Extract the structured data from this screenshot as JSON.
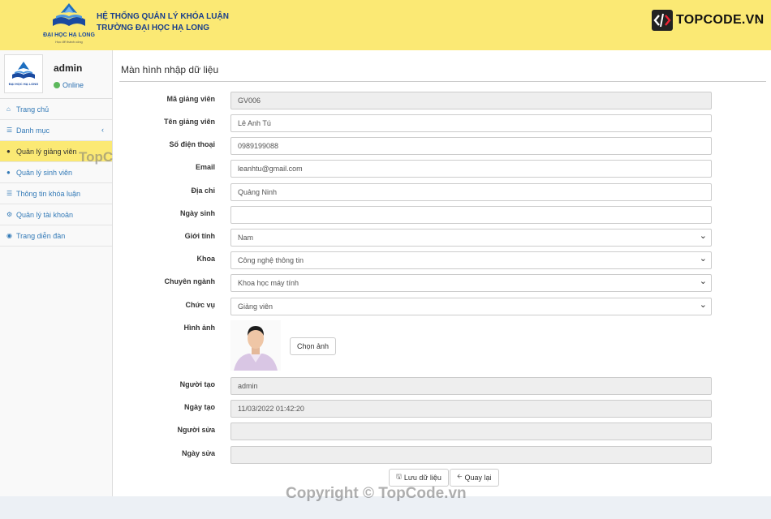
{
  "header": {
    "logo_text": "ĐẠI HỌC HẠ LONG",
    "logo_slogan": "Học để thành công",
    "title_line1": "HỆ THỐNG QUẢN LÝ KHÓA LUẬN",
    "title_line2": "TRƯỜNG ĐẠI HỌC HẠ LONG",
    "brand": "TOPCODE.VN"
  },
  "sidebar": {
    "avatar_text": "ĐẠI HỌC HẠ LONG",
    "user_name": "admin",
    "user_status": "Online",
    "items": [
      {
        "label": "Trang chủ",
        "icon": "home-icon"
      },
      {
        "label": "Danh mục",
        "icon": "list-icon"
      },
      {
        "label": "Quản lý giảng viên",
        "icon": "user-icon"
      },
      {
        "label": "Quản lý sinh viên",
        "icon": "users-icon"
      },
      {
        "label": "Thông tin khóa luận",
        "icon": "list-icon"
      },
      {
        "label": "Quản lý tài khoản",
        "icon": "gears-icon"
      },
      {
        "label": "Trang diễn đàn",
        "icon": "globe-icon"
      }
    ]
  },
  "page": {
    "title": "Màn hình nhập dữ liệu"
  },
  "form": {
    "ma_gv": {
      "label": "Mã giảng viên",
      "value": "GV006"
    },
    "ten_gv": {
      "label": "Tên giảng viên",
      "value": "Lê Anh Tú"
    },
    "sdt": {
      "label": "Số điện thoại",
      "value": "0989199088"
    },
    "email": {
      "label": "Email",
      "value": "leanhtu@gmail.com"
    },
    "dia_chi": {
      "label": "Địa chỉ",
      "value": "Quảng Ninh"
    },
    "ngay_sinh": {
      "label": "Ngày sinh",
      "value": ""
    },
    "gioi_tinh": {
      "label": "Giới tính",
      "value": "Nam"
    },
    "khoa": {
      "label": "Khoa",
      "value": "Công nghệ thông tin"
    },
    "chuyen_nganh": {
      "label": "Chuyên ngành",
      "value": "Khoa học máy tính"
    },
    "chuc_vu": {
      "label": "Chức vụ",
      "value": "Giảng viên"
    },
    "hinh_anh": {
      "label": "Hình ảnh",
      "button": "Chọn ảnh"
    },
    "nguoi_tao": {
      "label": "Người tạo",
      "value": "admin"
    },
    "ngay_tao": {
      "label": "Ngày tạo",
      "value": "11/03/2022 01:42:20"
    },
    "nguoi_sua": {
      "label": "Người sửa",
      "value": ""
    },
    "ngay_sua": {
      "label": "Ngày sửa",
      "value": ""
    }
  },
  "actions": {
    "save": "Lưu dữ liệu",
    "back": "Quay lại"
  },
  "watermarks": {
    "topcode": "TopCode.vn",
    "copyright": "Copyright © TopCode.vn"
  }
}
